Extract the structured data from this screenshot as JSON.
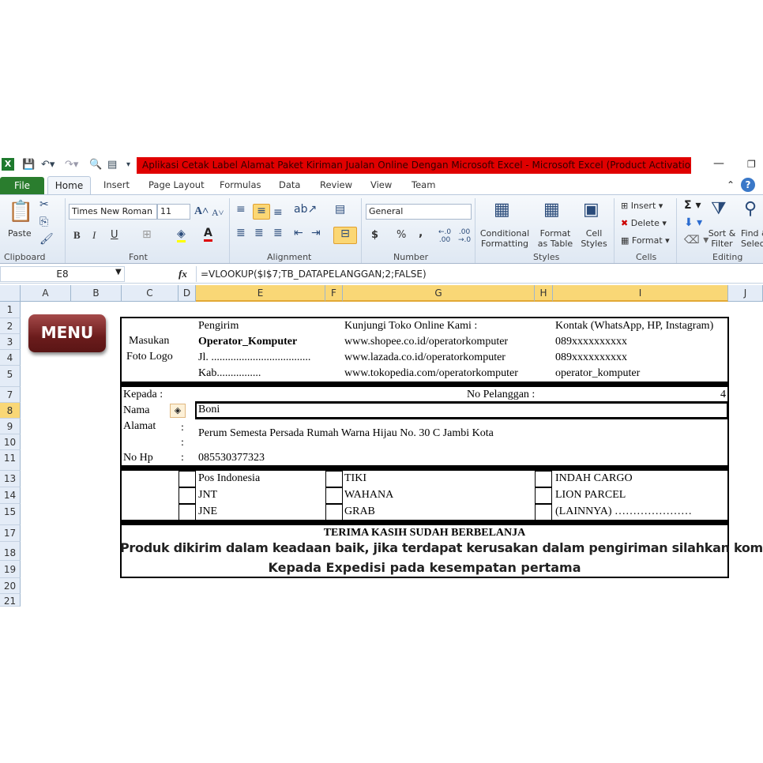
{
  "window": {
    "title": "Aplikasi Cetak Label Alamat Paket Kiriman Jualan Online Dengan Microsoft Excel  -  Microsoft Excel (Product Activation Failed)"
  },
  "tabs": [
    "File",
    "Home",
    "Insert",
    "Page Layout",
    "Formulas",
    "Data",
    "Review",
    "View",
    "Team"
  ],
  "ribbon": {
    "clipboard": {
      "paste": "Paste",
      "label": "Clipboard"
    },
    "font": {
      "name": "Times New Roman",
      "size": "11",
      "label": "Font",
      "bold": "B",
      "italic": "I",
      "underline": "U"
    },
    "alignment": {
      "label": "Alignment"
    },
    "number": {
      "format": "General",
      "label": "Number",
      "currency": "$",
      "percent": "%",
      "comma": ","
    },
    "styles": {
      "conditional": "Conditional Formatting",
      "format_table": "Format as Table",
      "cell_styles": "Cell Styles",
      "label": "Styles"
    },
    "cells": {
      "insert": "Insert",
      "delete": "Delete",
      "format": "Format",
      "label": "Cells"
    },
    "editing": {
      "sort": "Sort & Filter",
      "find": "Find & Select",
      "label": "Editing"
    }
  },
  "formula_bar": {
    "name_box": "E8",
    "fx": "fx",
    "formula": "=VLOOKUP($I$7;TB_DATAPELANGGAN;2;FALSE)"
  },
  "columns": [
    "A",
    "B",
    "C",
    "D",
    "E",
    "F",
    "G",
    "H",
    "I",
    "J"
  ],
  "rows": [
    "1",
    "2",
    "3",
    "4",
    "5",
    "7",
    "8",
    "9",
    "10",
    "11",
    "13",
    "14",
    "15",
    "17",
    "18",
    "19",
    "20",
    "21"
  ],
  "menu_button": "MENU",
  "label": {
    "logo": [
      "Masukan",
      "Foto Logo"
    ],
    "sender": [
      "Pengirim",
      "Operator_Komputer",
      "Jl. ....................................",
      "Kab................"
    ],
    "shop": [
      "Kunjungi Toko Online Kami :",
      "www.shopee.co.id/operatorkomputer",
      "www.lazada.co.id/operatorkomputer",
      "www.tokopedia.com/operatorkomputer"
    ],
    "contact": [
      "Kontak (WhatsApp, HP, Instagram)",
      "089xxxxxxxxxx",
      "089xxxxxxxxxx",
      "operator_komputer"
    ],
    "kepada": "Kepada :",
    "no_pelanggan_label": "No Pelanggan :",
    "no_pelanggan": "4",
    "nama_label": "Nama",
    "nama": "Boni",
    "alamat_label": "Alamat",
    "alamat": "Perum Semesta Persada Rumah Warna Hijau No. 30 C Jambi Kota",
    "nohp_label": "No Hp",
    "nohp": "085530377323",
    "colon": ":",
    "couriers": [
      [
        "Pos Indonesia",
        "JNT",
        "JNE"
      ],
      [
        "TIKI",
        "WAHANA",
        "GRAB"
      ],
      [
        "INDAH CARGO",
        "LION PARCEL",
        "(LAINNYA) …………………"
      ]
    ],
    "thanks": "TERIMA KASIH SUDAH BERBELANJA",
    "note1": "Produk dikirim dalam keadaan baik, jika terdapat kerusakan dalam pengiriman silahkan komplain",
    "note2": "Kepada Expedisi pada kesempatan pertama"
  }
}
